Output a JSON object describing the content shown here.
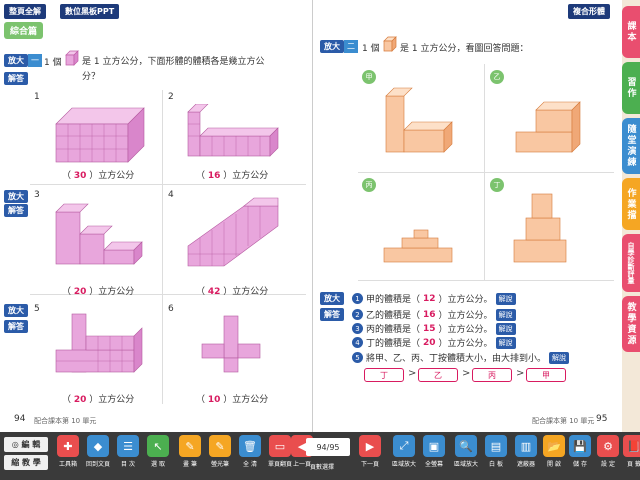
{
  "header": {
    "btn_whole": "整頁全解",
    "btn_ppt": "數位黑板PPT",
    "chapter": "複合形體",
    "section": "綜合篇"
  },
  "left": {
    "label_fang": "放大",
    "label_jie": "解答",
    "q1_prefix": "1 個",
    "q1_text": "是 1 立方公分，下面形體的體積各是幾立方公分？",
    "items": [
      {
        "n": "1",
        "ans": "30",
        "unit": "立方公分"
      },
      {
        "n": "2",
        "ans": "16",
        "unit": "立方公分"
      },
      {
        "n": "3",
        "ans": "20",
        "unit": "立方公分"
      },
      {
        "n": "4",
        "ans": "42",
        "unit": "立方公分"
      },
      {
        "n": "5",
        "ans": "20",
        "unit": "立方公分"
      },
      {
        "n": "6",
        "ans": "10",
        "unit": "立方公分"
      }
    ],
    "footer_num": "94",
    "footer_text": "配合課本第 10 單元"
  },
  "right": {
    "q_prefix": "1 個",
    "q_text": "是 1 立方公分，看圖回答問題：",
    "shapes": [
      "甲",
      "乙",
      "丙",
      "丁"
    ],
    "lines": [
      {
        "n": "1",
        "pre": "甲的體積是（",
        "ans": "12",
        "post": "）立方公分。"
      },
      {
        "n": "2",
        "pre": "乙的體積是（",
        "ans": "16",
        "post": "）立方公分。"
      },
      {
        "n": "3",
        "pre": "丙的體積是（",
        "ans": "15",
        "post": "）立方公分。"
      },
      {
        "n": "4",
        "pre": "丁的體積是（",
        "ans": "20",
        "post": "）立方公分。"
      },
      {
        "n": "5",
        "pre": "將甲、乙、丙、丁按體積大小，由大排到小。",
        "ans": "",
        "post": ""
      }
    ],
    "explain": "解說",
    "rank": [
      "丁",
      "乙",
      "丙",
      "甲"
    ],
    "gt": ">",
    "footer_num": "95",
    "footer_text": "配合課本第 10 單元"
  },
  "sidebar": {
    "tabs": [
      {
        "label": "課本",
        "color": "#e94e6f"
      },
      {
        "label": "習作",
        "color": "#4caf50"
      },
      {
        "label": "隨堂演練",
        "color": "#3b8dd0"
      },
      {
        "label": "作業擋",
        "color": "#f5a623"
      },
      {
        "label": "自學診斷評量",
        "color": "#e94e6f"
      },
      {
        "label": "教學資源",
        "color": "#e94e6f"
      }
    ]
  },
  "toolbar": {
    "left_top": "◎ 編 輯",
    "left_bottom": "縮 教 學",
    "page": "94/95",
    "tools": [
      {
        "label": "工具箱",
        "color": "#e94e4e"
      },
      {
        "label": "回到文頁",
        "color": "#3b8dd0"
      },
      {
        "label": "目 次",
        "color": "#3b8dd0"
      },
      {
        "label": "選 取",
        "color": "#4caf50"
      },
      {
        "label": "畫 筆",
        "color": "#f5a623"
      },
      {
        "label": "螢光筆",
        "color": "#f5a623"
      },
      {
        "label": "全 清",
        "color": "#3b8dd0"
      },
      {
        "label": "單頁翻頁",
        "color": "#e94e4e"
      },
      {
        "label": "上一頁",
        "color": "#e94e4e"
      },
      {
        "label": "頁數選擇",
        "color": "#555"
      },
      {
        "label": "下一頁",
        "color": "#e94e4e"
      },
      {
        "label": "區域放大",
        "color": "#3b8dd0"
      },
      {
        "label": "全螢幕",
        "color": "#3b8dd0"
      },
      {
        "label": "區域放大",
        "color": "#3b8dd0"
      },
      {
        "label": "白 板",
        "color": "#3b8dd0"
      },
      {
        "label": "遮蔽器",
        "color": "#3b8dd0"
      },
      {
        "label": "開 啟",
        "color": "#f5a623"
      },
      {
        "label": "儲 存",
        "color": "#3b8dd0"
      },
      {
        "label": "設 定",
        "color": "#e94e4e"
      },
      {
        "label": "頁 籤",
        "color": "#e94e4e"
      }
    ]
  }
}
